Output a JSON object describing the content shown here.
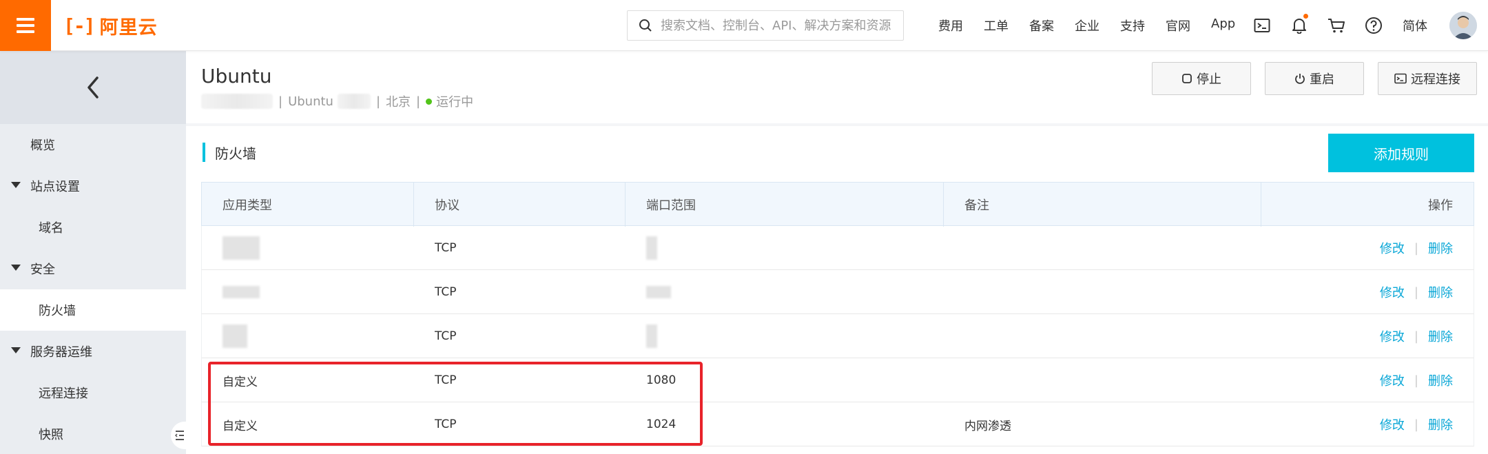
{
  "brand": {
    "name": "阿里云",
    "mark": "[-]",
    "accent": "#ff6a00"
  },
  "search": {
    "placeholder": "搜索文档、控制台、API、解决方案和资源"
  },
  "topnav": [
    "费用",
    "工单",
    "备案",
    "企业",
    "支持",
    "官网",
    "App"
  ],
  "lang": "简体",
  "sidebar": {
    "items": [
      {
        "label": "概览"
      },
      {
        "label": "站点设置"
      },
      {
        "label": "域名"
      },
      {
        "label": "安全"
      },
      {
        "label": "防火墙"
      },
      {
        "label": "服务器运维"
      },
      {
        "label": "远程连接"
      },
      {
        "label": "快照"
      }
    ]
  },
  "instance": {
    "name": "Ubuntu",
    "os": "Ubuntu",
    "region": "北京",
    "status": "运行中",
    "status_color": "#52c41a"
  },
  "actions": {
    "stop": "停止",
    "restart": "重启",
    "remote": "远程连接"
  },
  "firewall": {
    "title": "防火墙",
    "add_label": "添加规则",
    "columns": [
      "应用类型",
      "协议",
      "端口范围",
      "备注",
      "操作"
    ],
    "rows": [
      {
        "type": "",
        "protocol": "TCP",
        "port": "",
        "note": ""
      },
      {
        "type": "",
        "protocol": "TCP",
        "port": "",
        "note": ""
      },
      {
        "type": "",
        "protocol": "TCP",
        "port": "",
        "note": ""
      },
      {
        "type": "自定义",
        "protocol": "TCP",
        "port": "1080",
        "note": ""
      },
      {
        "type": "自定义",
        "protocol": "TCP",
        "port": "1024",
        "note": "内网渗透"
      }
    ],
    "edit_label": "修改",
    "delete_label": "删除",
    "link_color": "#0aa7d7"
  }
}
